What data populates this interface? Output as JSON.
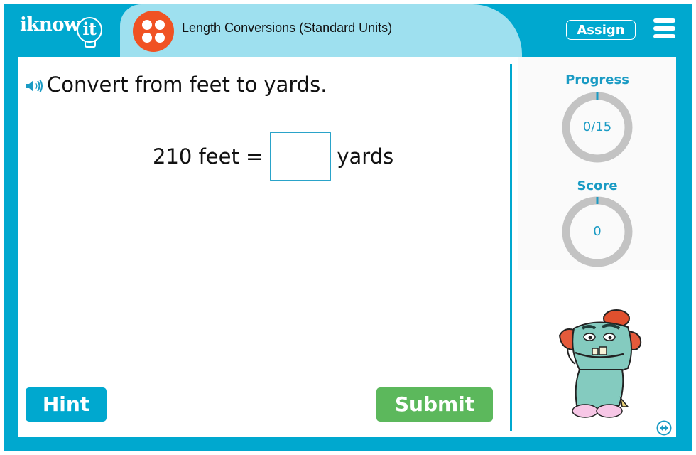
{
  "header": {
    "logo": "iknowit",
    "title": "Length Conversions (Standard Units)",
    "assign_label": "Assign",
    "icons": {
      "dice": "dice-icon",
      "menu": "hamburger-menu-icon"
    }
  },
  "question": {
    "prompt": "Convert from feet to yards.",
    "quantity": "210 feet =",
    "answer_value": "",
    "answer_placeholder": "",
    "unit": "yards",
    "speaker_icon": "speaker-icon"
  },
  "buttons": {
    "hint": "Hint",
    "submit": "Submit"
  },
  "stats": {
    "progress": {
      "label": "Progress",
      "value": "0/15",
      "fraction": 0
    },
    "score": {
      "label": "Score",
      "value": "0",
      "fraction": 0
    }
  },
  "colors": {
    "brand": "#00a8cf",
    "title_bg": "#9ee0ef",
    "dice": "#f05223",
    "submit": "#5cb85c",
    "ring_track": "#c3c3c3",
    "stat_text": "#1a9bc4"
  },
  "mascot": "monster-mascot",
  "expand_icon": "expand-horizontal-icon"
}
